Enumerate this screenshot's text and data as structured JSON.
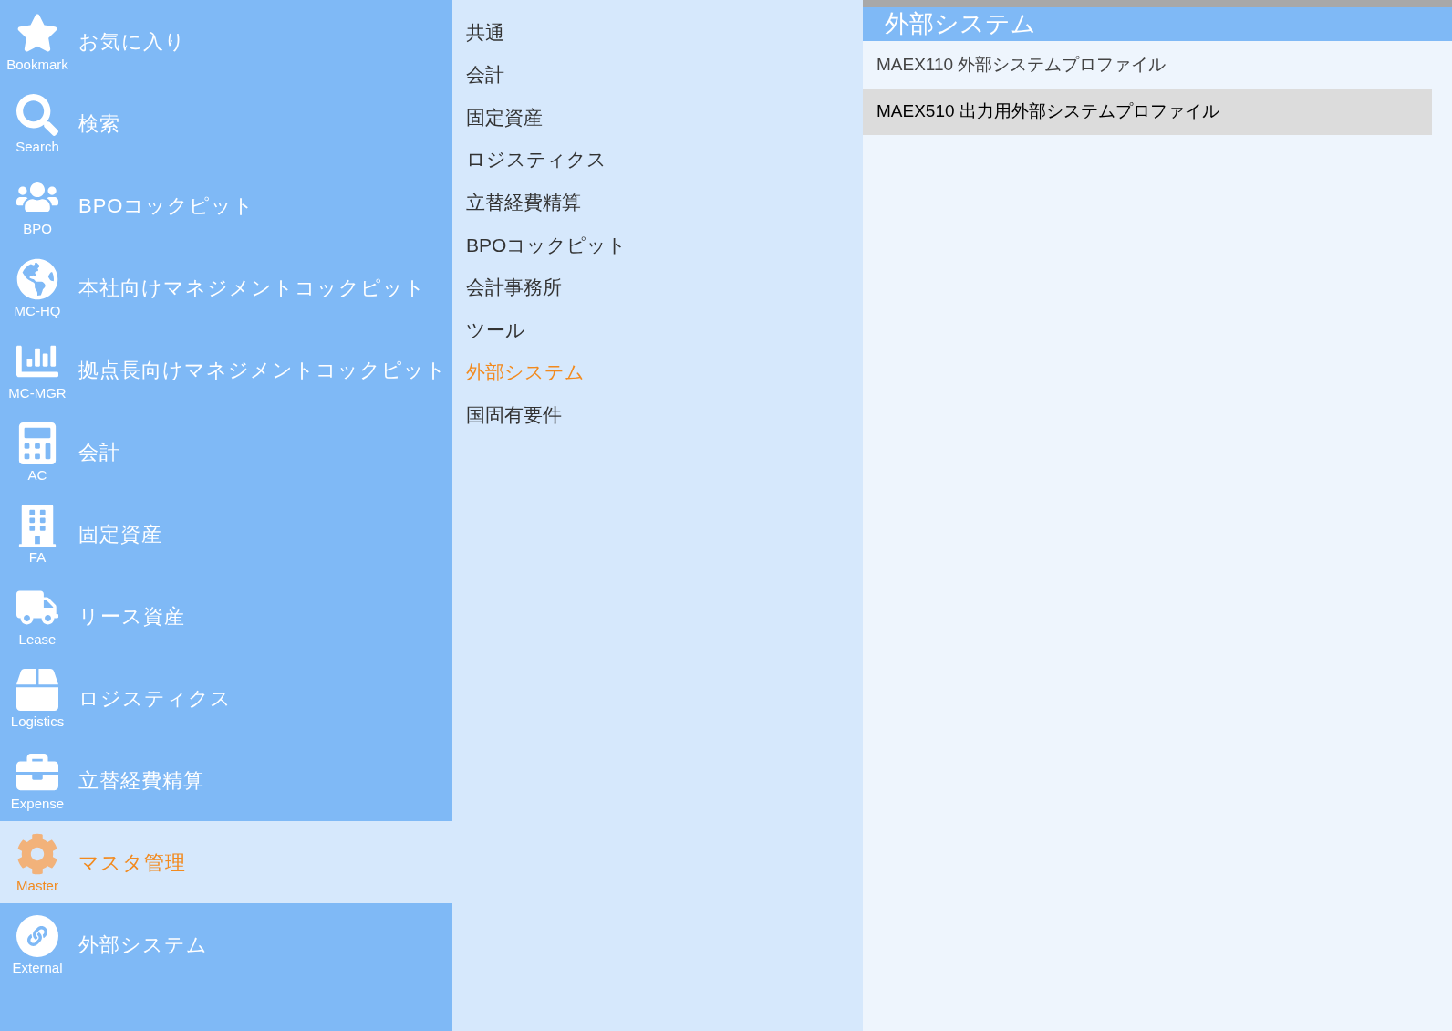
{
  "sidebar": {
    "items": [
      {
        "kind": "star",
        "label": "お気に入り",
        "caption": "Bookmark",
        "selected": false
      },
      {
        "kind": "search",
        "label": "検索",
        "caption": "Search",
        "selected": false
      },
      {
        "kind": "users",
        "label": "BPOコックピット",
        "caption": "BPO",
        "selected": false
      },
      {
        "kind": "globe",
        "label": "本社向けマネジメントコックピット",
        "caption": "MC-HQ",
        "selected": false
      },
      {
        "kind": "chart",
        "label": "拠点長向けマネジメントコックピット",
        "caption": "MC-MGR",
        "selected": false
      },
      {
        "kind": "calculator",
        "label": "会計",
        "caption": "AC",
        "selected": false
      },
      {
        "kind": "building",
        "label": "固定資産",
        "caption": "FA",
        "selected": false
      },
      {
        "kind": "truck",
        "label": "リース資産",
        "caption": "Lease",
        "selected": false
      },
      {
        "kind": "box",
        "label": "ロジスティクス",
        "caption": "Logistics",
        "selected": false
      },
      {
        "kind": "briefcase",
        "label": "立替経費精算",
        "caption": "Expense",
        "selected": false
      },
      {
        "kind": "gear",
        "label": "マスタ管理",
        "caption": "Master",
        "selected": true
      },
      {
        "kind": "link",
        "label": "外部システム",
        "caption": "External",
        "selected": false
      }
    ]
  },
  "categories": [
    {
      "label": "共通",
      "selected": false
    },
    {
      "label": "会計",
      "selected": false
    },
    {
      "label": "固定資産",
      "selected": false
    },
    {
      "label": "ロジスティクス",
      "selected": false
    },
    {
      "label": "立替経費精算",
      "selected": false
    },
    {
      "label": "BPOコックピット",
      "selected": false
    },
    {
      "label": "会計事務所",
      "selected": false
    },
    {
      "label": "ツール",
      "selected": false
    },
    {
      "label": "外部システム",
      "selected": true
    },
    {
      "label": "国固有要件",
      "selected": false
    }
  ],
  "panel": {
    "title": "外部システム",
    "items": [
      {
        "label": "MAEX110 外部システムプロファイル",
        "selected": false
      },
      {
        "label": "MAEX510 出力用外部システムプロファイル",
        "selected": true
      }
    ]
  }
}
